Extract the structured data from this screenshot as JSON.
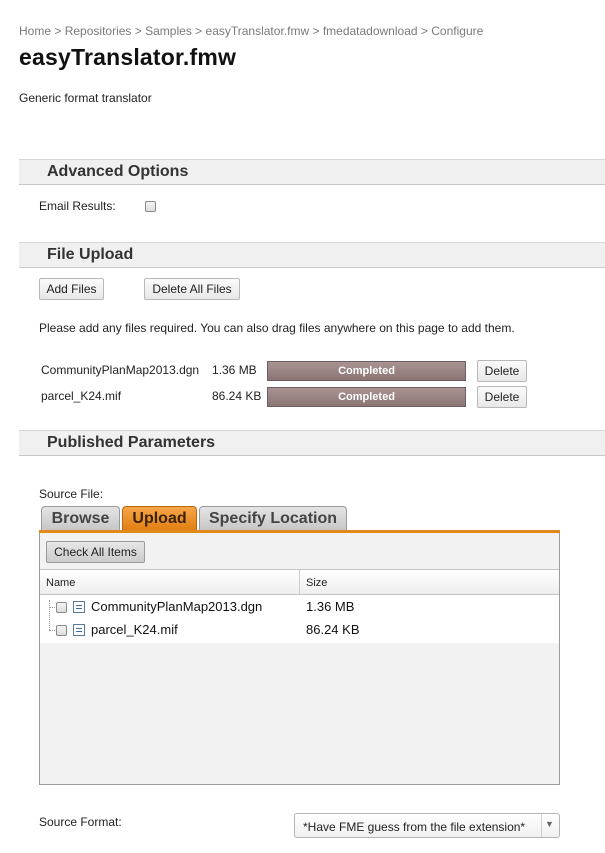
{
  "breadcrumb": [
    "Home",
    "Repositories",
    "Samples",
    "easyTranslator.fmw",
    "fmedatadownload",
    "Configure"
  ],
  "breadcrumb_sep": ">",
  "page": {
    "title": "easyTranslator.fmw",
    "description": "Generic format translator"
  },
  "advanced": {
    "heading": "Advanced Options",
    "email_label": "Email Results:"
  },
  "upload": {
    "heading": "File Upload",
    "add_label": "Add Files",
    "delete_all_label": "Delete All Files",
    "hint": "Please add any files required. You can also drag files anywhere on this page to add them.",
    "files": [
      {
        "name": "CommunityPlanMap2013.dgn",
        "size": "1.36 MB",
        "status": "Completed",
        "progress": 1.0,
        "delete_label": "Delete"
      },
      {
        "name": "parcel_K24.mif",
        "size": "86.24 KB",
        "status": "Completed",
        "progress": 1.0,
        "delete_label": "Delete"
      }
    ]
  },
  "params": {
    "heading": "Published Parameters",
    "source_file_label": "Source File:",
    "tabs": [
      "Browse",
      "Upload",
      "Specify Location"
    ],
    "active_tab": "Upload",
    "check_all_label": "Check All Items",
    "columns": [
      "Name",
      "Size"
    ],
    "rows": [
      {
        "name": "CommunityPlanMap2013.dgn",
        "size": "1.36 MB"
      },
      {
        "name": "parcel_K24.mif",
        "size": "86.24 KB"
      }
    ],
    "source_format_label": "Source Format:",
    "source_format_value": "*Have FME guess from the file extension*"
  },
  "colors": {
    "accent": "#e08a1c",
    "progress": "#8f7a7a"
  }
}
